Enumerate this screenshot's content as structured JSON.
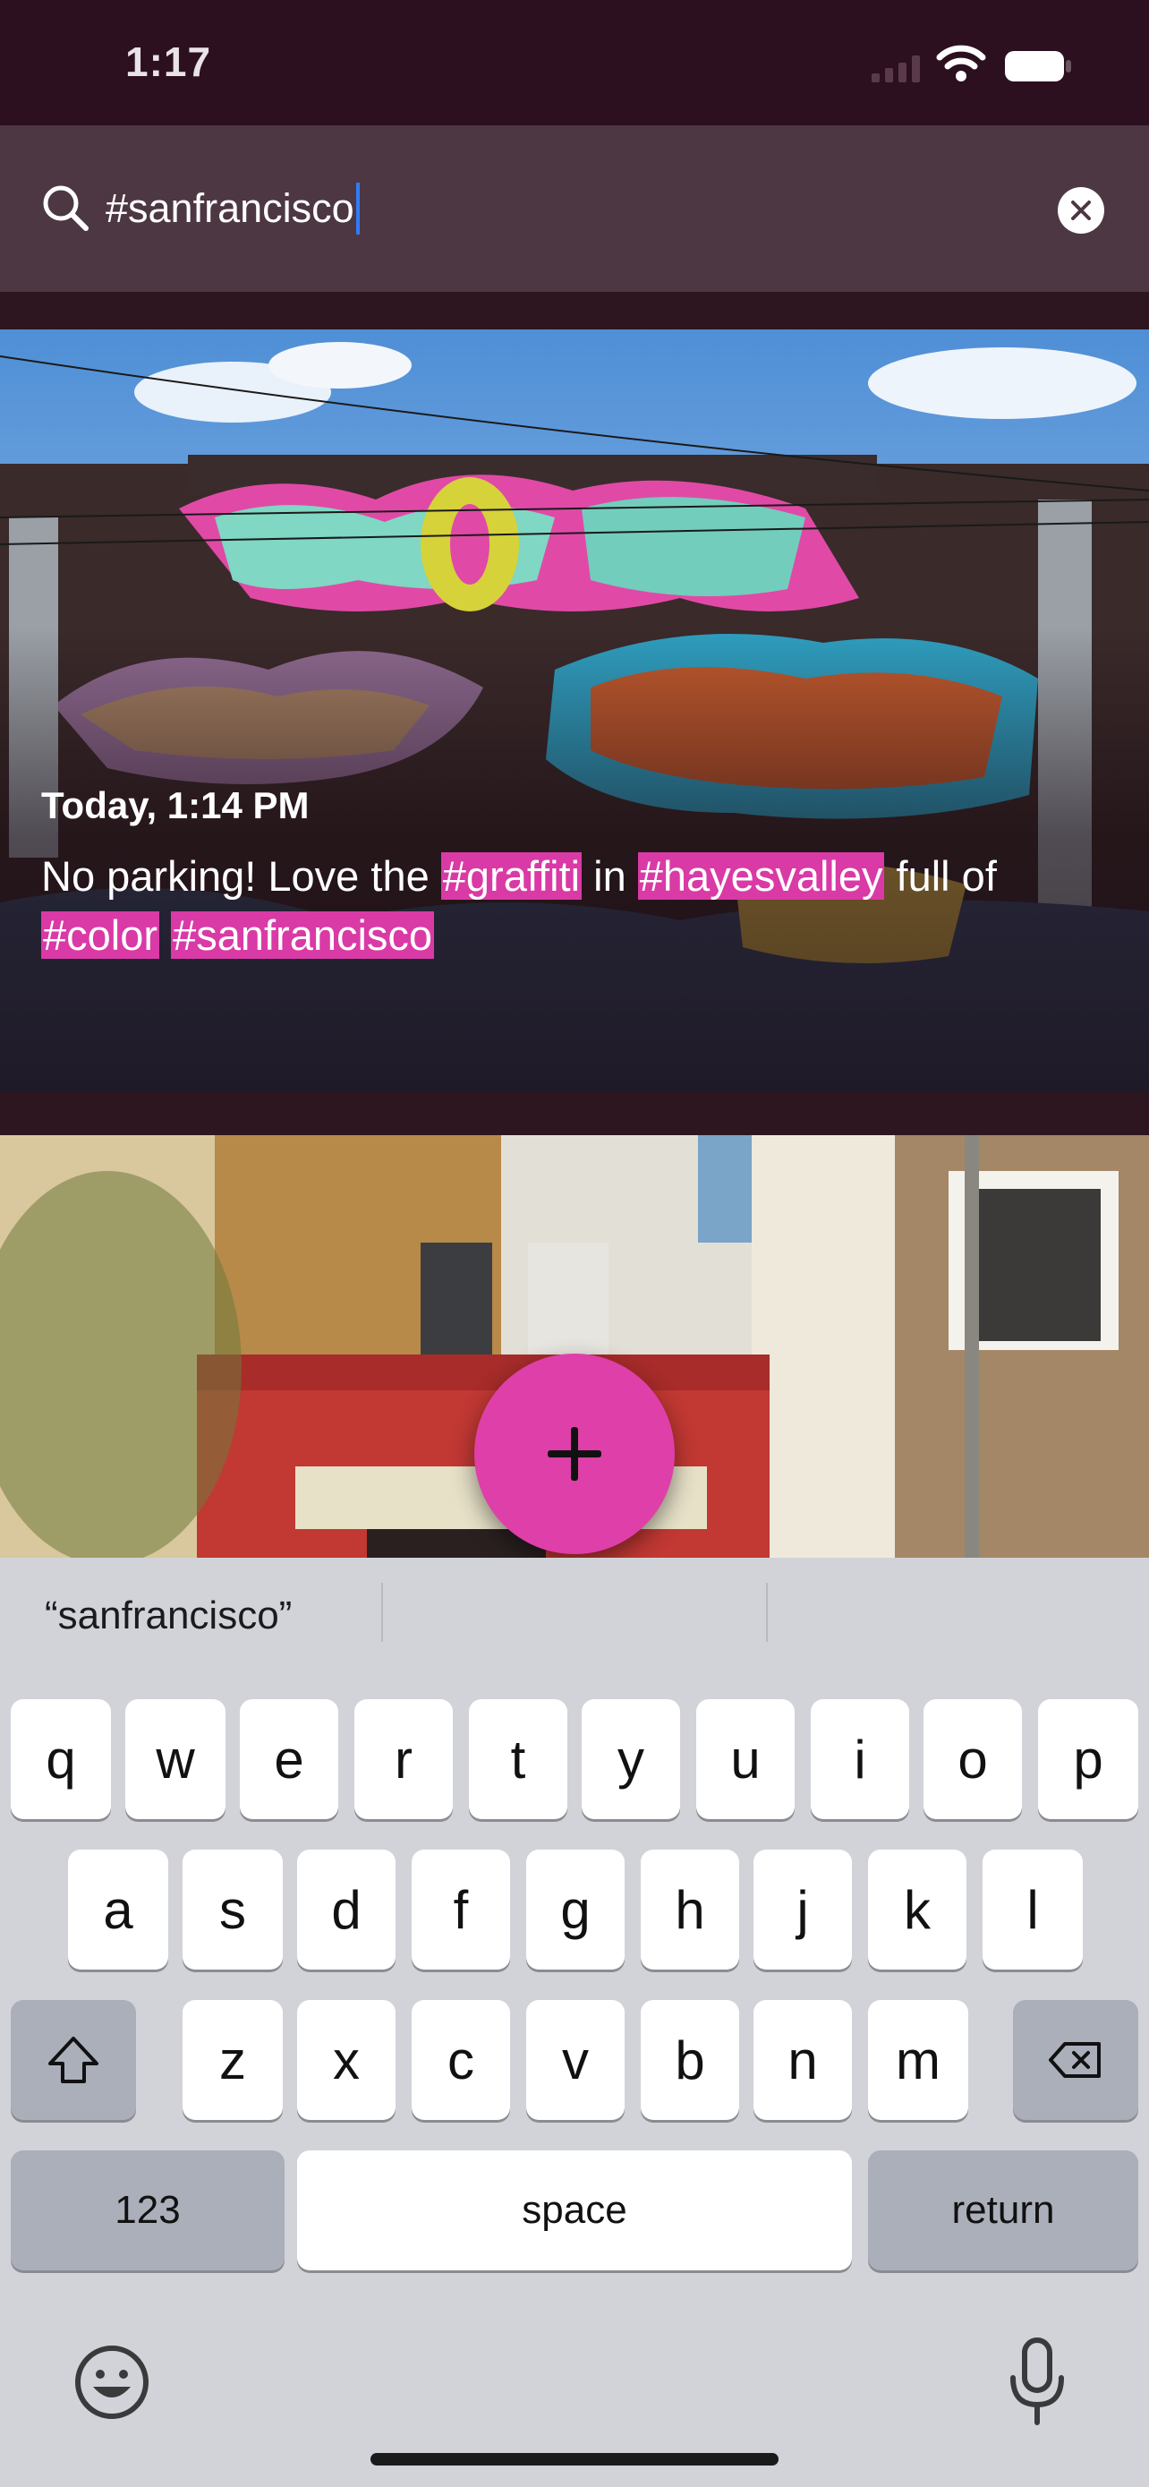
{
  "status_bar": {
    "time": "1:17"
  },
  "search": {
    "query": "#sanfrancisco"
  },
  "posts": [
    {
      "timestamp": "Today, 1:14 PM",
      "caption": [
        {
          "text": "No parking! Love the ",
          "tag": false
        },
        {
          "text": "#graffiti",
          "tag": true
        },
        {
          "text": " in ",
          "tag": false
        },
        {
          "text": "#hayesvalley",
          "tag": true
        },
        {
          "text": " full of ",
          "tag": false
        },
        {
          "text": "#color",
          "tag": true
        },
        {
          "text": " ",
          "tag": false
        },
        {
          "text": "#sanfrancisco",
          "tag": true
        }
      ]
    }
  ],
  "keyboard": {
    "suggestions": [
      "“sanfrancisco”",
      "",
      ""
    ],
    "row1": [
      "q",
      "w",
      "e",
      "r",
      "t",
      "y",
      "u",
      "i",
      "o",
      "p"
    ],
    "row2": [
      "a",
      "s",
      "d",
      "f",
      "g",
      "h",
      "j",
      "k",
      "l"
    ],
    "row3": [
      "z",
      "x",
      "c",
      "v",
      "b",
      "n",
      "m"
    ],
    "numbers_label": "123",
    "space_label": "space",
    "return_label": "return"
  },
  "colors": {
    "hashtag_highlight": "#d93aa6",
    "fab": "#df3fa8",
    "caret": "#2f7cf6"
  },
  "icons": {
    "search": "search-icon",
    "clear": "clear-icon",
    "add": "plus-icon",
    "shift": "shift-icon",
    "delete": "backspace-icon",
    "emoji": "emoji-icon",
    "mic": "microphone-icon"
  }
}
